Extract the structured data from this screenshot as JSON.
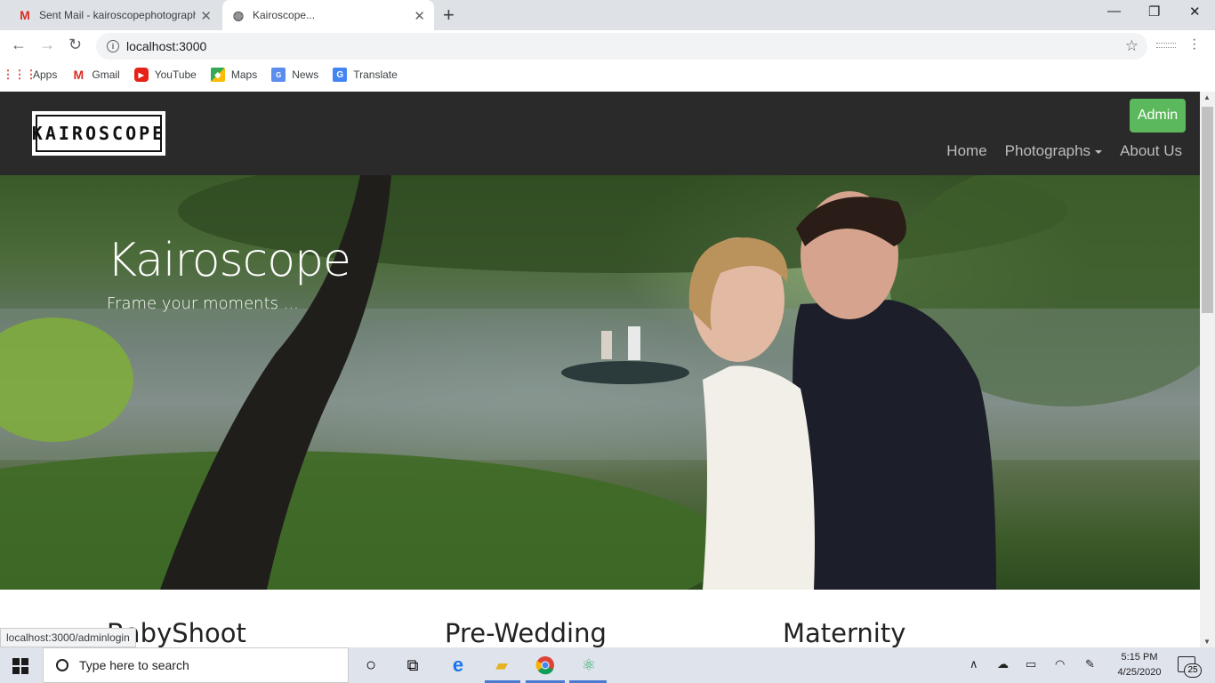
{
  "browser": {
    "tabs": [
      {
        "title": "Sent Mail - kairoscopephotograph",
        "favicon": "gmail-icon"
      },
      {
        "title": "Kairoscope...",
        "favicon": "globe-icon"
      }
    ],
    "url": "localhost:3000",
    "bookmarks": [
      {
        "label": "Apps",
        "icon": "apps-grid-icon"
      },
      {
        "label": "Gmail",
        "icon": "gmail-icon"
      },
      {
        "label": "YouTube",
        "icon": "youtube-icon"
      },
      {
        "label": "Maps",
        "icon": "maps-icon"
      },
      {
        "label": "News",
        "icon": "news-icon"
      },
      {
        "label": "Translate",
        "icon": "translate-icon"
      }
    ],
    "status_url": "localhost:3000/adminlogin"
  },
  "site": {
    "logo_text": "KAIROSCOPE",
    "admin_label": "Admin",
    "nav": {
      "home": "Home",
      "photographs": "Photographs",
      "about": "About Us"
    },
    "hero": {
      "title": "Kairoscope",
      "subtitle": "Frame your moments ..."
    },
    "categories": [
      "BabyShoot",
      "Pre-Wedding",
      "Maternity"
    ]
  },
  "taskbar": {
    "search_placeholder": "Type here to search",
    "time": "5:15 PM",
    "date": "4/25/2020",
    "notification_count": "25"
  },
  "colors": {
    "admin_button": "#5cb85c",
    "navbar_bg": "#2a2a2b"
  }
}
